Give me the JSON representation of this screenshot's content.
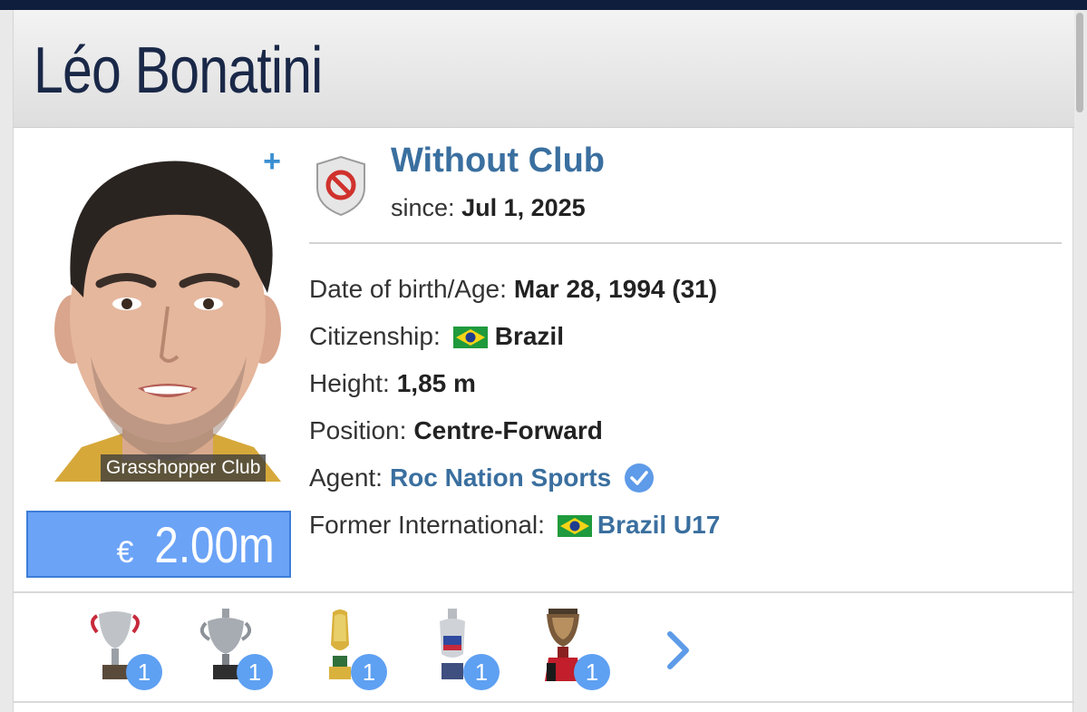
{
  "player": {
    "name": "Léo Bonatini",
    "portrait_caption": "Grasshopper Club",
    "market_value_currency": "€",
    "market_value_amount": "2.00m"
  },
  "club": {
    "name": "Without Club",
    "since_label": "since:",
    "since_value": "Jul 1, 2025"
  },
  "info": {
    "dob_label": "Date of birth/Age:",
    "dob_value": "Mar 28, 1994 (31)",
    "citizenship_label": "Citizenship:",
    "citizenship_value": "Brazil",
    "height_label": "Height:",
    "height_value": "1,85 m",
    "position_label": "Position:",
    "position_value": "Centre-Forward",
    "agent_label": "Agent:",
    "agent_value": "Roc Nation Sports",
    "former_intl_label": "Former International:",
    "former_intl_value": "Brazil U17"
  },
  "trophies": [
    {
      "icon": "trophy-icon",
      "count": "1"
    },
    {
      "icon": "trophy-icon",
      "count": "1"
    },
    {
      "icon": "trophy-icon",
      "count": "1"
    },
    {
      "icon": "trophy-icon",
      "count": "1"
    },
    {
      "icon": "trophy-icon",
      "count": "1"
    }
  ],
  "colors": {
    "header_text": "#1a2848",
    "link": "#3a6f9f",
    "market_value_bg": "#6ba3f7",
    "badge": "#5ea0f2",
    "topbar": "#0f1e3d"
  }
}
